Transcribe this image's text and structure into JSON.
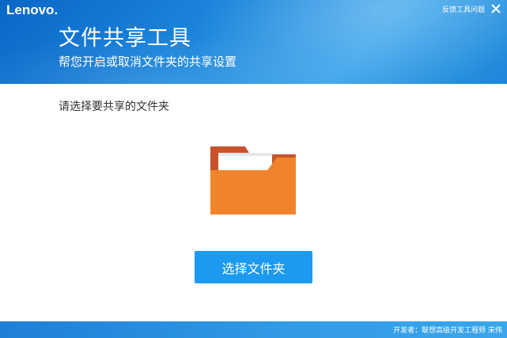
{
  "header": {
    "brand": "Lenovo.",
    "feedback_label": "反馈工具问题",
    "title": "文件共享工具",
    "subtitle": "帮您开启或取消文件夹的共享设置"
  },
  "main": {
    "prompt": "请选择要共享的文件夹",
    "select_button_label": "选择文件夹",
    "folder_icon": "folder-icon"
  },
  "footer": {
    "developer_text": "开发者：联想高级开发工程师 宋伟"
  },
  "colors": {
    "header_blue": "#1b86dc",
    "button_blue": "#1c9af0",
    "folder_front": "#f0842d",
    "folder_back": "#c8532a"
  }
}
